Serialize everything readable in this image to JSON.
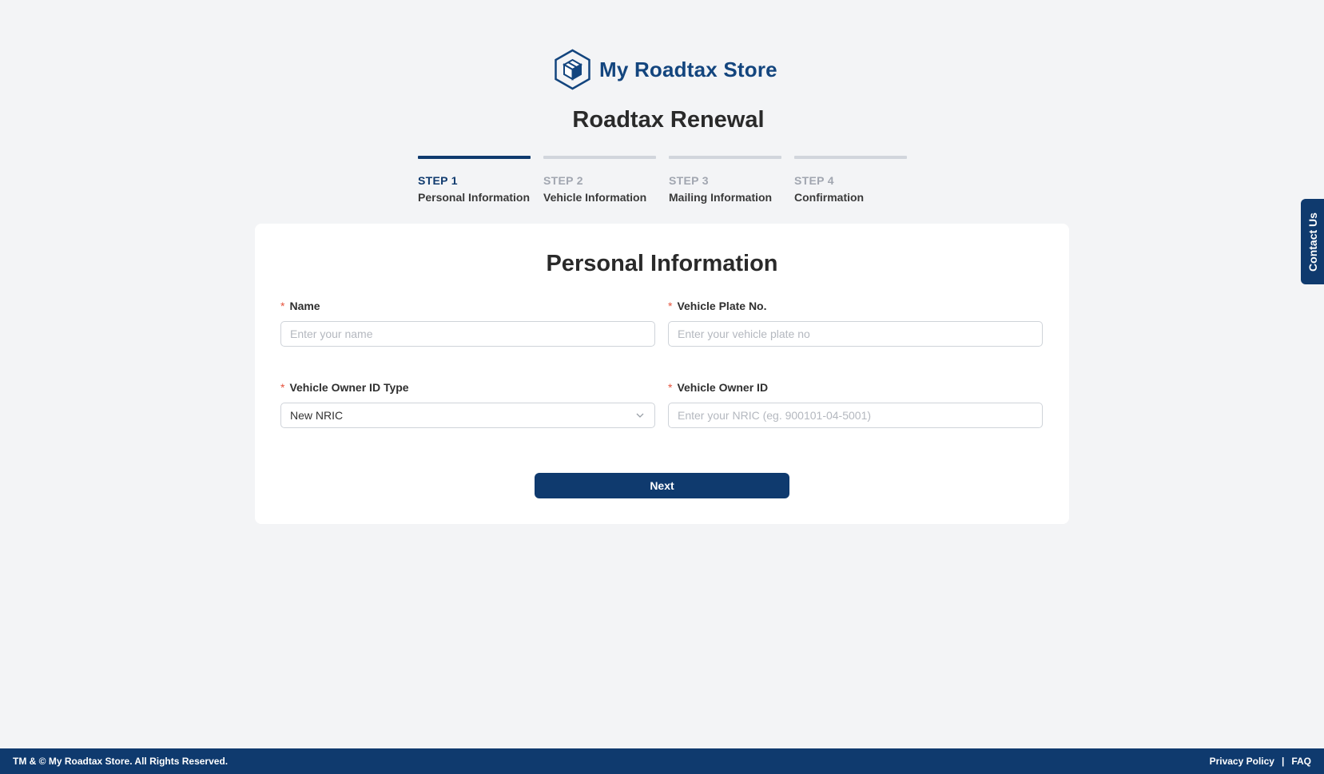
{
  "brand": {
    "name": "My Roadtax Store",
    "logo_icon": "hexagon-box-icon",
    "color": "#13457e"
  },
  "page_title": "Roadtax Renewal",
  "steps": [
    {
      "number": "STEP 1",
      "label": "Personal Information",
      "active": true
    },
    {
      "number": "STEP 2",
      "label": "Vehicle Information",
      "active": false
    },
    {
      "number": "STEP 3",
      "label": "Mailing Information",
      "active": false
    },
    {
      "number": "STEP 4",
      "label": "Confirmation",
      "active": false
    }
  ],
  "form": {
    "title": "Personal Information",
    "required_marker": "*",
    "fields": {
      "name": {
        "label": "Name",
        "value": "",
        "placeholder": "Enter your name"
      },
      "plate": {
        "label": "Vehicle Plate No.",
        "value": "",
        "placeholder": "Enter your vehicle plate no"
      },
      "id_type": {
        "label": "Vehicle Owner ID Type",
        "value": "New NRIC",
        "icon": "chevron-down-icon"
      },
      "owner_id": {
        "label": "Vehicle Owner ID",
        "value": "",
        "placeholder": "Enter your NRIC (eg. 900101-04-5001)"
      }
    },
    "next_label": "Next"
  },
  "contact_tab": "Contact Us",
  "footer": {
    "copyright": "TM & © My Roadtax Store. All Rights Reserved.",
    "links": [
      "Privacy Policy",
      "FAQ"
    ],
    "separator": "|"
  },
  "colors": {
    "primary": "#0f3a6e",
    "background": "#f3f4f6",
    "required": "#e5533d",
    "inactive_step": "#d1d5dc"
  }
}
